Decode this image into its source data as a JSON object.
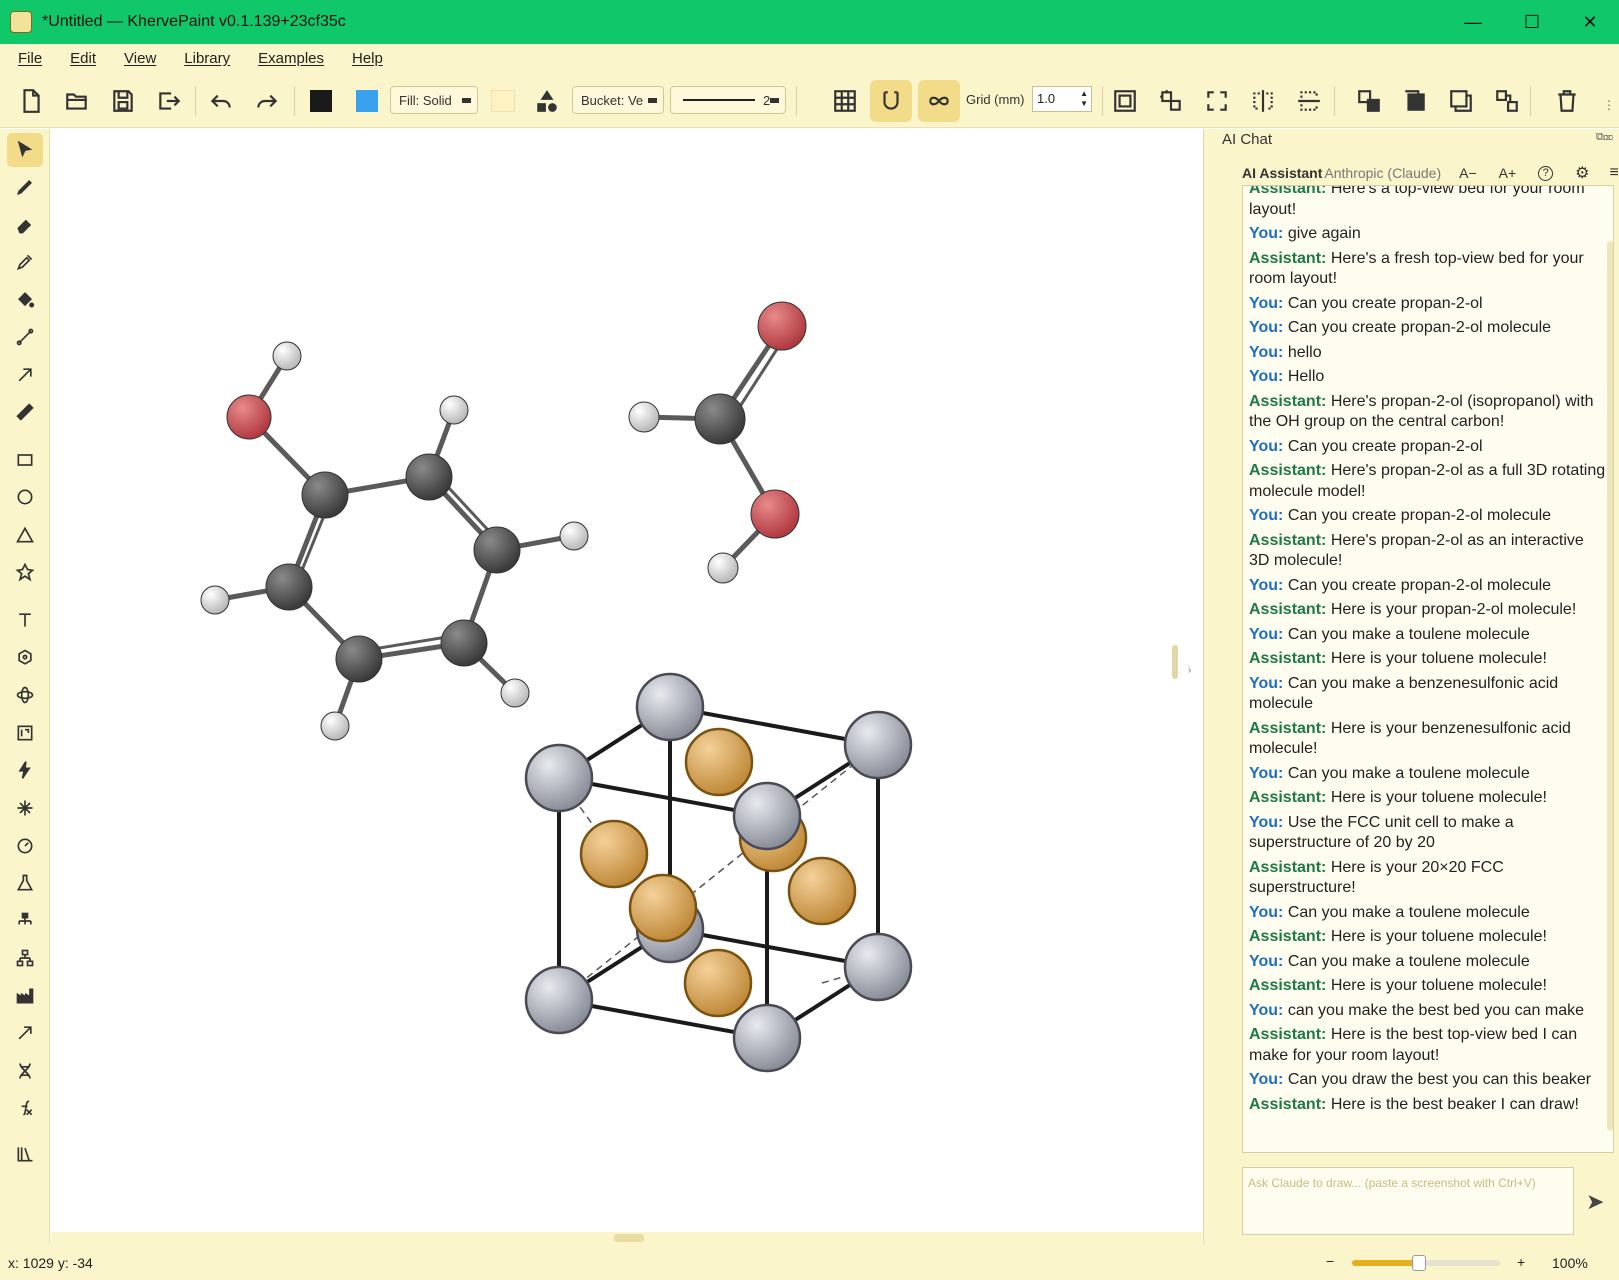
{
  "window": {
    "title": "*Untitled — KhervePaint v0.1.139+23cf35c"
  },
  "menu": [
    "File",
    "Edit",
    "View",
    "Library",
    "Examples",
    "Help"
  ],
  "toolbar": {
    "fill_label": "Fill: Solid",
    "bucket_label": "Bucket: Ve",
    "stroke_value": "2",
    "grid_label": "Grid (mm)",
    "grid_value": "1.0",
    "stroke_color": "#1a1a1a",
    "fill_color": "#3aa0f0",
    "bg_color": "#fff8d8"
  },
  "chat": {
    "panel_title": "AI Chat",
    "assistant_label": "AI Assistant",
    "provider": "Anthropic (Claude)",
    "font_minus": "A−",
    "font_plus": "A+",
    "input_placeholder": "Ask Claude to draw... (paste a screenshot with Ctrl+V)",
    "messages": [
      {
        "who": "Assistant:",
        "role": "as",
        "text": "Here's a top-view bed for your room layout!"
      },
      {
        "who": "You:",
        "role": "you",
        "text": "give again"
      },
      {
        "who": "Assistant:",
        "role": "as",
        "text": "Here's a fresh top-view bed for your room layout!"
      },
      {
        "who": "You:",
        "role": "you",
        "text": "Can you create propan-2-ol"
      },
      {
        "who": "You:",
        "role": "you",
        "text": "Can you create propan-2-ol molecule"
      },
      {
        "who": "You:",
        "role": "you",
        "text": "hello"
      },
      {
        "who": "You:",
        "role": "you",
        "text": "Hello"
      },
      {
        "who": "Assistant:",
        "role": "as",
        "text": "Here's propan-2-ol (isopropanol) with the OH group on the central carbon!"
      },
      {
        "who": "You:",
        "role": "you",
        "text": "Can you create propan-2-ol"
      },
      {
        "who": "Assistant:",
        "role": "as",
        "text": "Here's propan-2-ol as a full 3D rotating molecule model!"
      },
      {
        "who": "You:",
        "role": "you",
        "text": "Can you create propan-2-ol molecule"
      },
      {
        "who": "Assistant:",
        "role": "as",
        "text": "Here's propan-2-ol as an interactive 3D molecule!"
      },
      {
        "who": "You:",
        "role": "you",
        "text": "Can you create propan-2-ol molecule"
      },
      {
        "who": "Assistant:",
        "role": "as",
        "text": "Here is your propan-2-ol molecule!"
      },
      {
        "who": "You:",
        "role": "you",
        "text": "Can you make a toulene molecule"
      },
      {
        "who": "Assistant:",
        "role": "as",
        "text": "Here is your toluene molecule!"
      },
      {
        "who": "You:",
        "role": "you",
        "text": "Can you make a benzenesulfonic acid molecule"
      },
      {
        "who": "Assistant:",
        "role": "as",
        "text": "Here is your benzenesulfonic acid molecule!"
      },
      {
        "who": "You:",
        "role": "you",
        "text": "Can you make a toulene molecule"
      },
      {
        "who": "Assistant:",
        "role": "as",
        "text": "Here is your toluene molecule!"
      },
      {
        "who": "You:",
        "role": "you",
        "text": "Use the FCC unit cell to make a superstructure of 20 by 20"
      },
      {
        "who": "Assistant:",
        "role": "as",
        "text": "Here is your 20×20 FCC superstructure!"
      },
      {
        "who": "You:",
        "role": "you",
        "text": "Can you make a toulene molecule"
      },
      {
        "who": "Assistant:",
        "role": "as",
        "text": "Here is your toluene molecule!"
      },
      {
        "who": "You:",
        "role": "you",
        "text": "Can you make a toulene molecule"
      },
      {
        "who": "Assistant:",
        "role": "as",
        "text": "Here is your toluene molecule!"
      },
      {
        "who": "You:",
        "role": "you",
        "text": "can you make the best bed you can make"
      },
      {
        "who": "Assistant:",
        "role": "as",
        "text": "Here is the best top-view bed I can make for your room layout!"
      },
      {
        "who": "You:",
        "role": "you",
        "text": "Can you draw the best you can this beaker"
      },
      {
        "who": "Assistant:",
        "role": "as",
        "text": "Here is the best beaker I can draw!"
      }
    ]
  },
  "status": {
    "coords": "x: 1029  y: -34",
    "zoom": "100%",
    "zoom_level": 0.45,
    "zoom_minus": "−",
    "zoom_plus": "+"
  }
}
